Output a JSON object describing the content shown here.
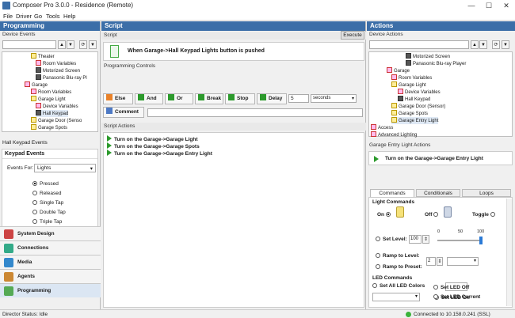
{
  "window": {
    "title": "Composer Pro 3.0.0 - Residence (Remote)",
    "min": "—",
    "max": "☐",
    "close": "✕"
  },
  "menu": [
    "File",
    "Driver",
    "Go",
    "Tools",
    "Help"
  ],
  "left": {
    "header": "Programming",
    "device_events_label": "Device Events",
    "tree": [
      {
        "label": "Theater",
        "icon": "yel"
      },
      {
        "label": "Room Variables",
        "icon": "red"
      },
      {
        "label": "Motorized Screen",
        "icon": "dk"
      },
      {
        "label": "Panasonic Blu-ray Pl",
        "icon": "dk"
      },
      {
        "label": "Garage",
        "icon": "red"
      },
      {
        "label": "Room Variables",
        "icon": "red"
      },
      {
        "label": "Garage Light",
        "icon": "yel"
      },
      {
        "label": "Device Variables",
        "icon": "red"
      },
      {
        "label": "Hall Keypad",
        "icon": "dk"
      },
      {
        "label": "Garage Door (Senso",
        "icon": "yel"
      },
      {
        "label": "Garage Spots",
        "icon": "yel"
      }
    ],
    "events_label": "Hall Keypad Events",
    "events_title": "Keypad Events",
    "events_for_label": "Events For:",
    "events_for_value": "Lights",
    "options": [
      "Pressed",
      "Released",
      "Single Tap",
      "Double Tap",
      "Triple Tap"
    ],
    "nav": [
      "System Design",
      "Connections",
      "Media",
      "Agents",
      "Programming"
    ]
  },
  "script": {
    "header": "Script",
    "label": "Script",
    "execute": "Execute",
    "trigger": "When Garage->Hall Keypad Lights button is pushed",
    "pc_label": "Programming Controls",
    "buttons": [
      "Else",
      "And",
      "Or",
      "Break",
      "Stop",
      "Delay"
    ],
    "delay_value": "5",
    "delay_unit": "seconds",
    "comment": "Comment",
    "actions_label": "Script Actions",
    "actions": [
      "Turn on the Garage->Garage Light",
      "Turn on the Garage->Garage Spots",
      "Turn on the Garage->Garage Entry Light"
    ]
  },
  "actions": {
    "header": "Actions",
    "device_actions_label": "Device Actions",
    "tree": [
      {
        "label": "Motorized Screen",
        "icon": "dk"
      },
      {
        "label": "Panasonic Blu-ray Player",
        "icon": "dk"
      },
      {
        "label": "Garage",
        "icon": "red"
      },
      {
        "label": "Room Variables",
        "icon": "red"
      },
      {
        "label": "Garage Light",
        "icon": "yel"
      },
      {
        "label": "Device Variables",
        "icon": "red"
      },
      {
        "label": "Hall Keypad",
        "icon": "dk"
      },
      {
        "label": "Garage Door (Sensor)",
        "icon": "yel"
      },
      {
        "label": "Garage Spots",
        "icon": "yel"
      },
      {
        "label": "Garage Entry Light",
        "icon": "yel"
      },
      {
        "label": "Access",
        "icon": "red"
      },
      {
        "label": "Advanced Lighting",
        "icon": "red"
      }
    ],
    "entry_label": "Garage Entry Light Actions",
    "entry_action": "Turn on the Garage->Garage Entry Light",
    "tabs": [
      "Commands",
      "Conditionals",
      "Loops"
    ],
    "light_commands": "Light Commands",
    "on": "On",
    "off": "Off",
    "toggle": "Toggle",
    "set_level": "Set Level:",
    "level_value": "100",
    "slider_ticks": [
      "0",
      "50",
      "100"
    ],
    "ramp_level": "Ramp to Level:",
    "ramp_preset": "Ramp to Preset:",
    "ramp_value": "2",
    "led_commands": "LED Commands",
    "set_all_led": "Set All LED Colors",
    "led_on": "Set LED On",
    "led_off": "Set LED Off",
    "led_current": "Set LED Current"
  },
  "status": {
    "left": "Director Status: Idle",
    "right": "Connected to 10.158.0.241 (SSL)"
  }
}
